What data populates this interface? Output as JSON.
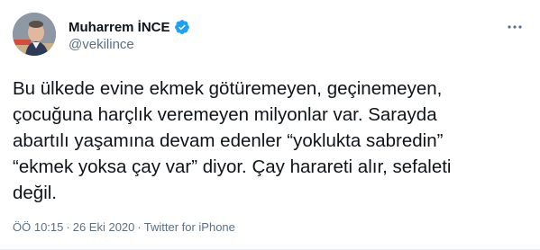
{
  "author": {
    "display_name": "Muharrem İNCE",
    "handle": "@vekilince",
    "verified": true,
    "avatar_icon": "profile-photo"
  },
  "tweet": {
    "text": "Bu ülkede evine ekmek götüremeyen, geçinemeyen,\nçocuğuna harçlık veremeyen milyonlar var. Sarayda\nabartılı yaşamına devam edenler “yoklukta sabredin”\n“ekmek yoksa çay var” diyor. Çay harareti alır, sefaleti\ndeğil."
  },
  "meta": {
    "time": "ÖÖ 10:15",
    "separator": "·",
    "date": "26 Eki 2020",
    "source": "Twitter for iPhone"
  },
  "colors": {
    "verified_blue": "#1da1f2",
    "secondary_text": "#5b7083",
    "primary_text": "#0f1419"
  },
  "icons": {
    "more": "more-options-icon",
    "verified": "verified-badge-icon"
  }
}
